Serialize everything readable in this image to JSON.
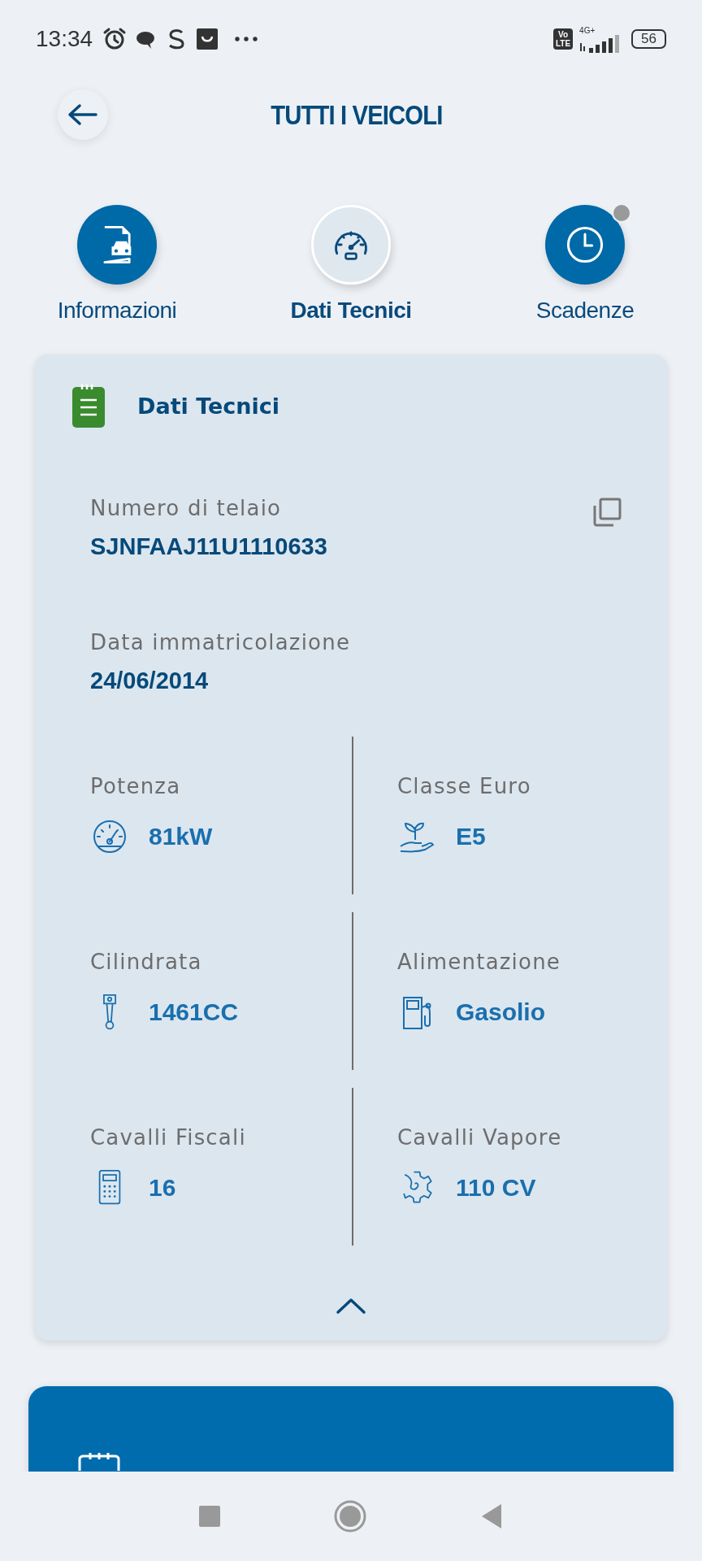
{
  "status_bar": {
    "time": "13:34",
    "volte": [
      "Vo",
      "LTE"
    ],
    "network": "4G+",
    "battery": "56"
  },
  "header": {
    "title": "TUTTI I VEICOLI"
  },
  "tabs": [
    {
      "label": "Informazioni",
      "selected": false,
      "kind": "info",
      "badge": false
    },
    {
      "label": "Dati Tecnici",
      "selected": true,
      "kind": "specs",
      "badge": false
    },
    {
      "label": "Scadenze",
      "selected": false,
      "kind": "deadlines",
      "badge": true
    }
  ],
  "card": {
    "title": "Dati Tecnici",
    "expanded": true,
    "fields": [
      {
        "label": "Numero di telaio",
        "value": "SJNFAAJ11U1110633",
        "copyable": true
      },
      {
        "label": "Data immatricolazione",
        "value": "24/06/2014",
        "copyable": false
      }
    ],
    "specs": [
      {
        "label": "Potenza",
        "value": "81kW",
        "kind": "power"
      },
      {
        "label": "Classe Euro",
        "value": "E5",
        "kind": "euro"
      },
      {
        "label": "Cilindrata",
        "value": "1461CC",
        "kind": "displacement"
      },
      {
        "label": "Alimentazione",
        "value": "Gasolio",
        "kind": "fuel"
      },
      {
        "label": "Cavalli Fiscali",
        "value": "16",
        "kind": "fiscal"
      },
      {
        "label": "Cavalli Vapore",
        "value": "110 CV",
        "kind": "horsepower"
      }
    ]
  }
}
